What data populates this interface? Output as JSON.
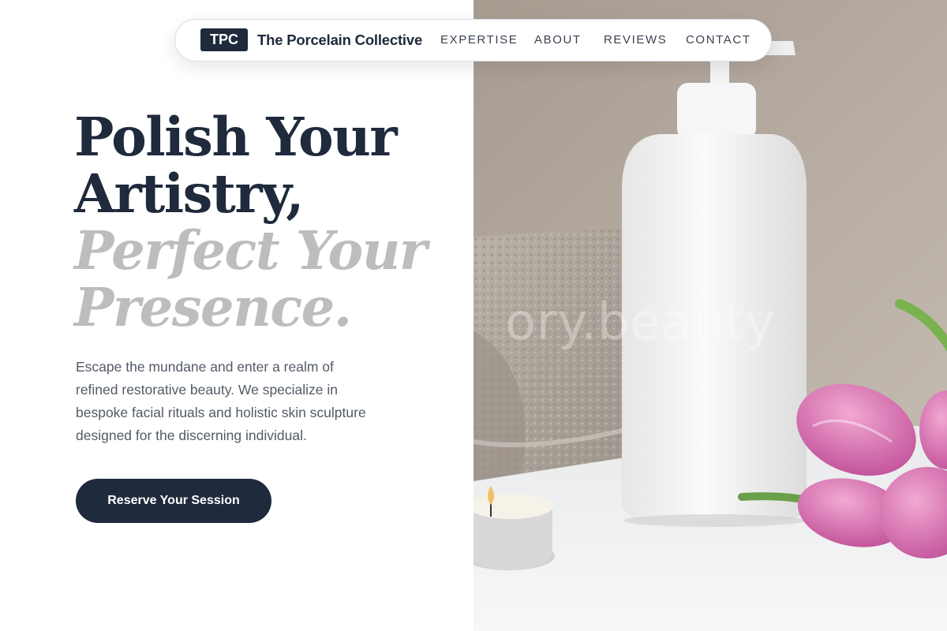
{
  "nav": {
    "logo_badge": "TPC",
    "brand_name": "The Porcelain Collective",
    "links": [
      "EXPERTISE",
      "ABOUT",
      "REVIEWS",
      "CONTACT"
    ]
  },
  "hero": {
    "headline_lines": [
      "Polish Your",
      "Artistry,",
      "Perfect Your",
      "Presence."
    ],
    "intro_lines": [
      "Escape the mundane and enter a realm of",
      "refined restorative beauty. We specialize in",
      "bespoke facial rituals and holistic skin sculpture",
      "designed for the discerning individual."
    ],
    "cta_label": "Reserve Your Session"
  },
  "image": {
    "watermark": "ory.beauty",
    "subjects": [
      "towel",
      "lotion-bottle",
      "tealight-candle",
      "tulips"
    ]
  },
  "colors": {
    "primary": "#1f2a3c",
    "headline_muted": "#bdbdbd",
    "body_text": "#525a66",
    "accent_tulip": "#d877b4"
  }
}
